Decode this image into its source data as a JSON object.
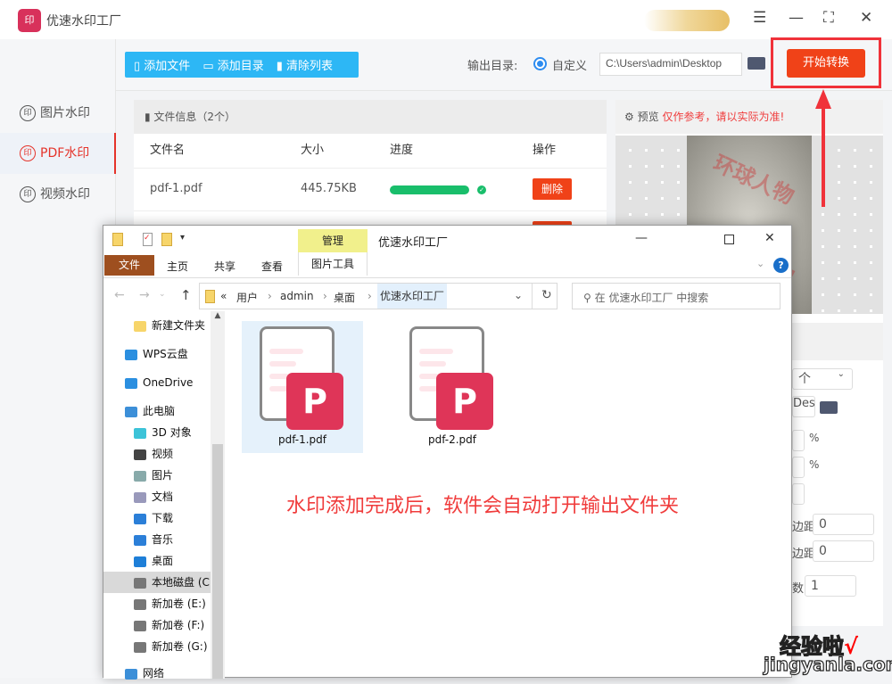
{
  "app": {
    "title": "优速水印工厂",
    "logo_text": "印"
  },
  "window_controls": {
    "menu": "☰",
    "minimize": "—",
    "maximize": "⛶",
    "close": "✕"
  },
  "sidebar": {
    "items": [
      {
        "label": "图片水印",
        "active": false
      },
      {
        "label": "PDF水印",
        "active": true
      },
      {
        "label": "视频水印",
        "active": false
      }
    ],
    "icon": "印"
  },
  "toolbar": {
    "add_file": "添加文件",
    "add_dir": "添加目录",
    "clear_list": "清除列表",
    "output_label": "输出目录:",
    "radio_label": "自定义",
    "output_path": "C:\\Users\\admin\\Desktop",
    "start": "开始转换"
  },
  "files": {
    "header": "文件信息（2个）",
    "columns": [
      "文件名",
      "大小",
      "进度",
      "操作"
    ],
    "rows": [
      {
        "name": "pdf-1.pdf",
        "size": "445.75KB",
        "progress": 100,
        "action": "删除"
      }
    ]
  },
  "preview": {
    "label": "预览",
    "note": "仅作参考，请以实际为准!",
    "watermark": "环球人物"
  },
  "settings": {
    "select_partial": "个",
    "path_partial": "Des",
    "percent1": "%",
    "percent2": "%",
    "label1": "边距",
    "value1": "0",
    "label2": "边距",
    "value2": "0",
    "label3": "数",
    "value3": "1"
  },
  "explorer": {
    "title": "优速水印工厂",
    "manage_tab": "管理",
    "ribbon_tabs": [
      "文件",
      "主页",
      "共享",
      "查看",
      "图片工具"
    ],
    "breadcrumb": [
      "«",
      "用户",
      "admin",
      "桌面",
      "优速水印工厂"
    ],
    "search_placeholder": "在 优速水印工厂 中搜索",
    "nav": [
      {
        "label": "新建文件夹",
        "icon": "folder"
      },
      {
        "label": "WPS云盘",
        "icon": "cloud"
      },
      {
        "label": "OneDrive",
        "icon": "cloud"
      },
      {
        "label": "此电脑",
        "icon": "pc"
      },
      {
        "label": "3D 对象",
        "icon": "cube"
      },
      {
        "label": "视频",
        "icon": "video"
      },
      {
        "label": "图片",
        "icon": "picture"
      },
      {
        "label": "文档",
        "icon": "document"
      },
      {
        "label": "下载",
        "icon": "download"
      },
      {
        "label": "音乐",
        "icon": "music"
      },
      {
        "label": "桌面",
        "icon": "desktop"
      },
      {
        "label": "本地磁盘 (C:)",
        "icon": "drive"
      },
      {
        "label": "新加卷 (E:)",
        "icon": "drive"
      },
      {
        "label": "新加卷 (F:)",
        "icon": "drive"
      },
      {
        "label": "新加卷 (G:)",
        "icon": "drive"
      },
      {
        "label": "网络",
        "icon": "network"
      }
    ],
    "files": [
      {
        "name": "pdf-1.pdf",
        "selected": true
      },
      {
        "name": "pdf-2.pdf",
        "selected": false
      }
    ]
  },
  "annotation": "水印添加完成后，软件会自动打开输出文件夹",
  "site_watermark": {
    "line1": "经验啦",
    "check": "√",
    "line2": "jingyanla.com"
  },
  "colors": {
    "accent_blue": "#2db7f5",
    "start_button": "#f04218",
    "progress": "#19be6b",
    "annotation": "#f03c3c",
    "file_tab": "#9e4f1f",
    "manage_tab": "#f1f08c"
  }
}
